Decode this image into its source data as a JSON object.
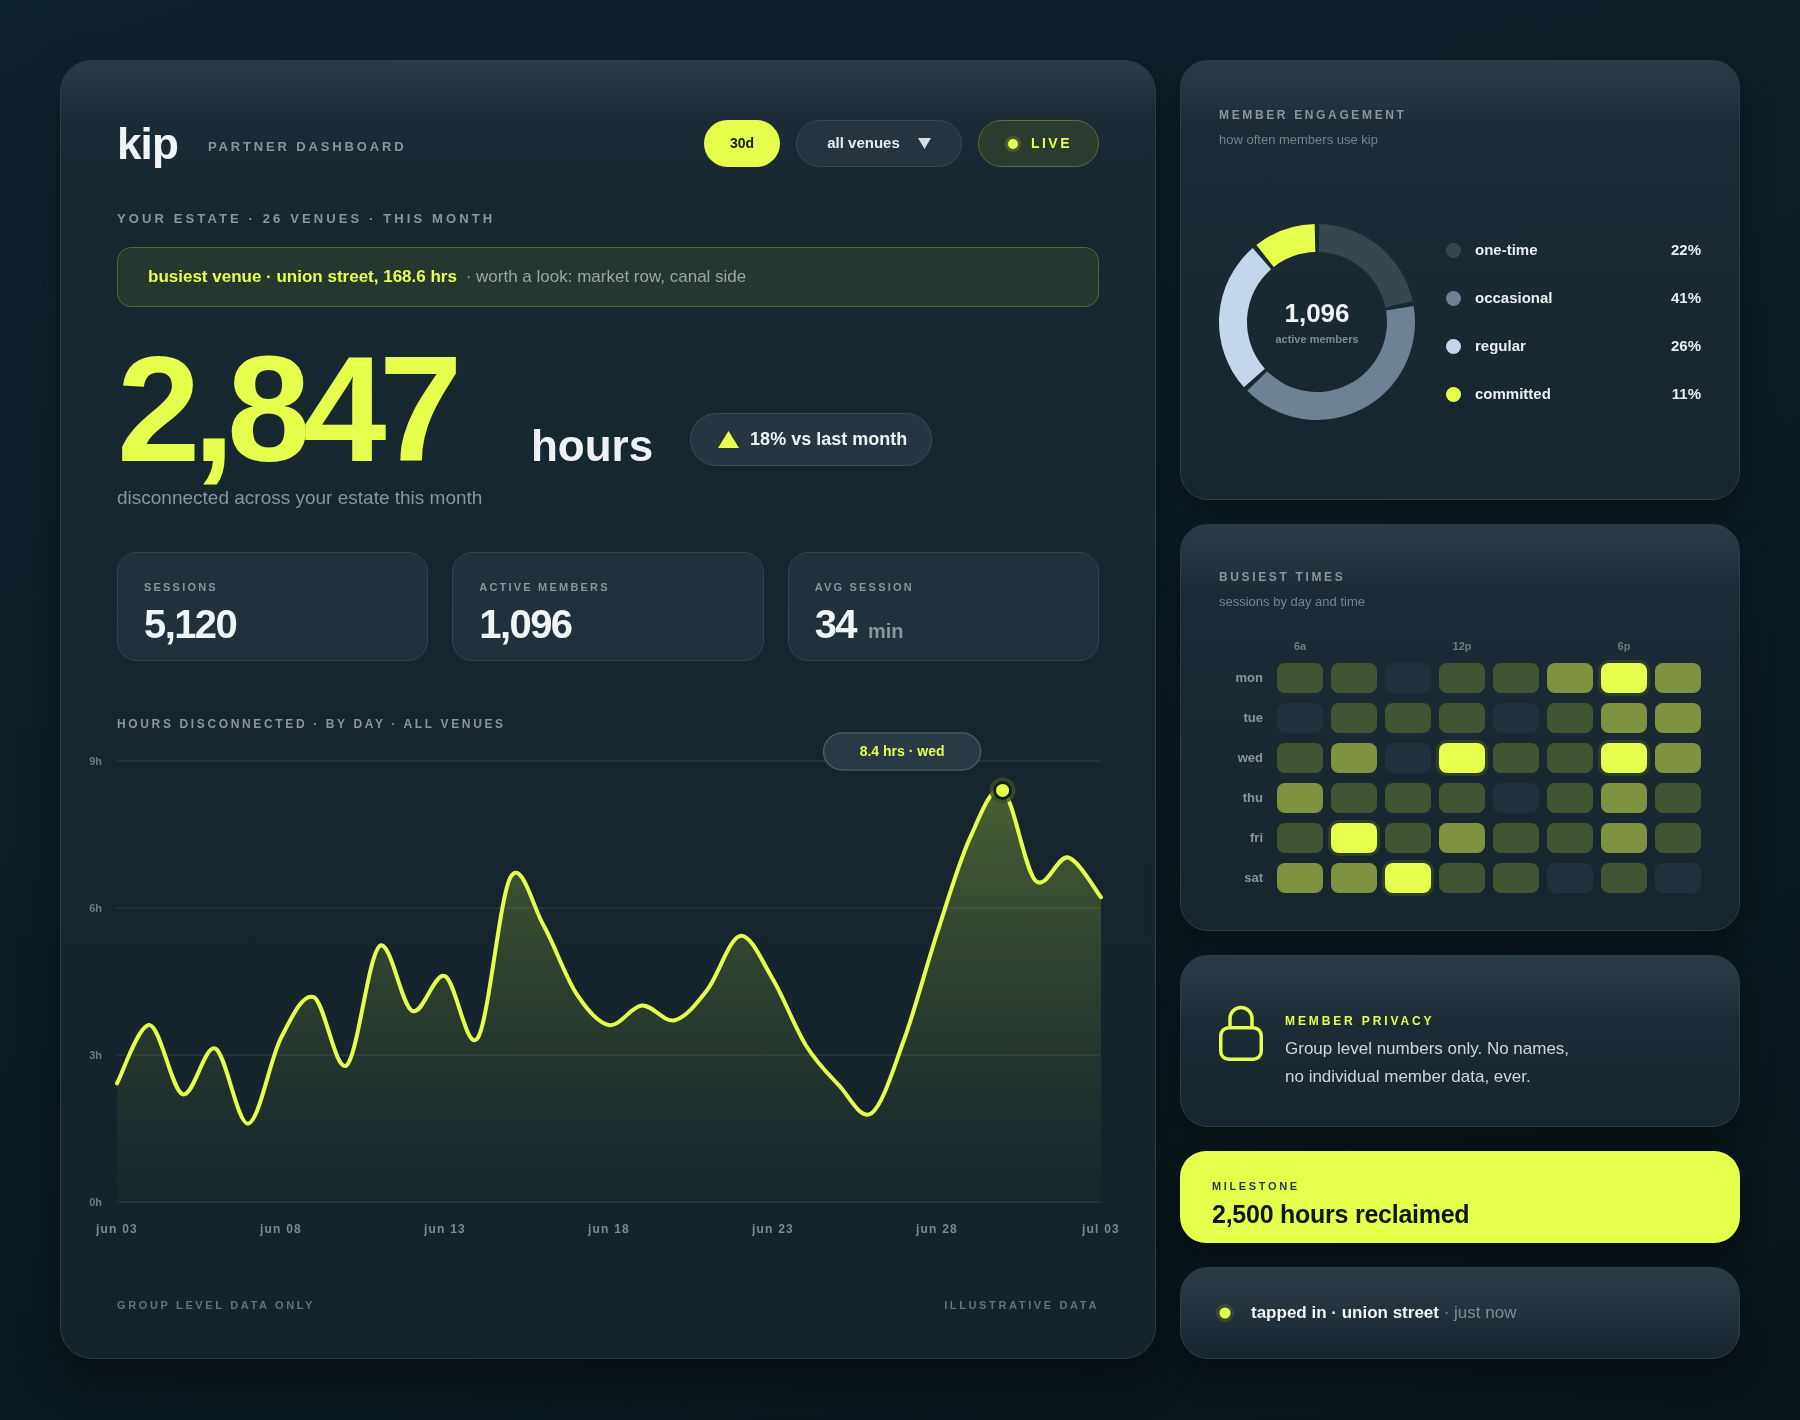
{
  "header": {
    "logo": "kip",
    "subtitle": "PARTNER DASHBOARD",
    "period": {
      "label": "30d",
      "selected": true
    },
    "venue_filter": {
      "value": "all venues"
    },
    "live": {
      "label": "LIVE",
      "on": true
    }
  },
  "estate_line": "YOUR ESTATE · 26 VENUES · THIS MONTH",
  "highlight_banner": "**busiest venue · union street, 168.6 hrs** · worth a look: market row, canal side",
  "headline": {
    "value": "2,847",
    "unit": "hours",
    "trend": "18% vs last month",
    "caption": "disconnected across your estate this month"
  },
  "stats": [
    {
      "label": "SESSIONS",
      "value": "5,120"
    },
    {
      "label": "ACTIVE MEMBERS",
      "value": "1,096"
    },
    {
      "label": "AVG SESSION",
      "value": "34",
      "unit": "min"
    }
  ],
  "hours_chart": {
    "chart_data": {
      "type": "area",
      "title": "HOURS DISCONNECTED · BY DAY · ALL VENUES",
      "categories": [
        "jun 03",
        null,
        null,
        null,
        null,
        "jun 08",
        null,
        null,
        null,
        null,
        "jun 13",
        null,
        null,
        null,
        null,
        "jun 18",
        null,
        null,
        null,
        null,
        "jun 23",
        null,
        null,
        null,
        null,
        "jun 28",
        null,
        null,
        null,
        null,
        "jul 03"
      ],
      "ylim": [
        0,
        9
      ],
      "yticks": [
        {
          "value": 0,
          "label": "0h"
        },
        {
          "value": 3,
          "label": "3h"
        },
        {
          "value": 6,
          "label": "6h"
        },
        {
          "value": 9,
          "label": "9h"
        }
      ],
      "series": [
        {
          "color": "#e6ff4d",
          "values": [
            2.42,
            3.61,
            2.2,
            3.13,
            1.6,
            3.35,
            4.18,
            2.79,
            5.22,
            3.9,
            4.61,
            3.35,
            6.63,
            5.65,
            4.26,
            3.61,
            4.01,
            3.71,
            4.33,
            5.43,
            4.54,
            3.2,
            2.39,
            1.81,
            3.32,
            5.48,
            7.42,
            8.4,
            6.56,
            7.03,
            6.22
          ]
        }
      ],
      "annotations": [
        "8.4 hrs · wed"
      ]
    }
  },
  "footer": {
    "left": "GROUP LEVEL DATA ONLY",
    "right": "ILLUSTRATIVE DATA"
  },
  "engagement": {
    "title": "MEMBER ENGAGEMENT",
    "subtitle": "how often members use kip",
    "chart_data": {
      "type": "donut",
      "values": [
        22,
        41,
        26,
        11
      ]
    },
    "center_value": "1,096",
    "center_label": "active members",
    "legend": [
      {
        "label": "one-time",
        "value": "22%",
        "color": "#384650"
      },
      {
        "label": "occasional",
        "value": "41%",
        "color": "#6f8293"
      },
      {
        "label": "regular",
        "value": "26%",
        "color": "#c4d7ea"
      },
      {
        "label": "committed",
        "value": "11%",
        "color": "#e6ff4d"
      }
    ]
  },
  "busiest_times": {
    "title": "BUSIEST TIMES",
    "subtitle": "sessions by day and time",
    "column_labels": [
      "6a",
      "12p",
      "6p"
    ],
    "rows": [
      {
        "day": "mon",
        "cells": [
          {
            "kind": "low"
          },
          {
            "kind": "low"
          },
          {
            "kind": "empty"
          },
          {
            "kind": "low"
          },
          {
            "kind": "low"
          },
          {
            "kind": "mid"
          },
          {
            "kind": "peak"
          },
          {
            "kind": "mid"
          }
        ]
      },
      {
        "day": "tue",
        "cells": [
          {
            "kind": "empty"
          },
          {
            "kind": "low"
          },
          {
            "kind": "low"
          },
          {
            "kind": "low"
          },
          {
            "kind": "empty"
          },
          {
            "kind": "low"
          },
          {
            "kind": "mid"
          },
          {
            "kind": "mid"
          }
        ]
      },
      {
        "day": "wed",
        "cells": [
          {
            "kind": "low"
          },
          {
            "kind": "mid"
          },
          {
            "kind": "empty"
          },
          {
            "kind": "peak"
          },
          {
            "kind": "low"
          },
          {
            "kind": "low"
          },
          {
            "kind": "peak"
          },
          {
            "kind": "mid"
          }
        ]
      },
      {
        "day": "thu",
        "cells": [
          {
            "kind": "mid"
          },
          {
            "kind": "low"
          },
          {
            "kind": "low"
          },
          {
            "kind": "low"
          },
          {
            "kind": "empty"
          },
          {
            "kind": "low"
          },
          {
            "kind": "mid"
          },
          {
            "kind": "low"
          }
        ]
      },
      {
        "day": "fri",
        "cells": [
          {
            "kind": "low"
          },
          {
            "kind": "peak"
          },
          {
            "kind": "low"
          },
          {
            "kind": "mid"
          },
          {
            "kind": "low"
          },
          {
            "kind": "low"
          },
          {
            "kind": "mid"
          },
          {
            "kind": "low"
          }
        ]
      },
      {
        "day": "sat",
        "cells": [
          {
            "kind": "mid"
          },
          {
            "kind": "mid"
          },
          {
            "kind": "peak"
          },
          {
            "kind": "low"
          },
          {
            "kind": "low"
          },
          {
            "kind": "empty"
          },
          {
            "kind": "low"
          },
          {
            "kind": "empty"
          }
        ]
      }
    ]
  },
  "privacy": {
    "title": "MEMBER PRIVACY",
    "text": "Group level numbers only. No names, no individual member data, ever."
  },
  "milestone": {
    "label": "MILESTONE",
    "text": "2,500 hours reclaimed"
  },
  "activity": {
    "text": "**tapped in · union street** · just now"
  }
}
